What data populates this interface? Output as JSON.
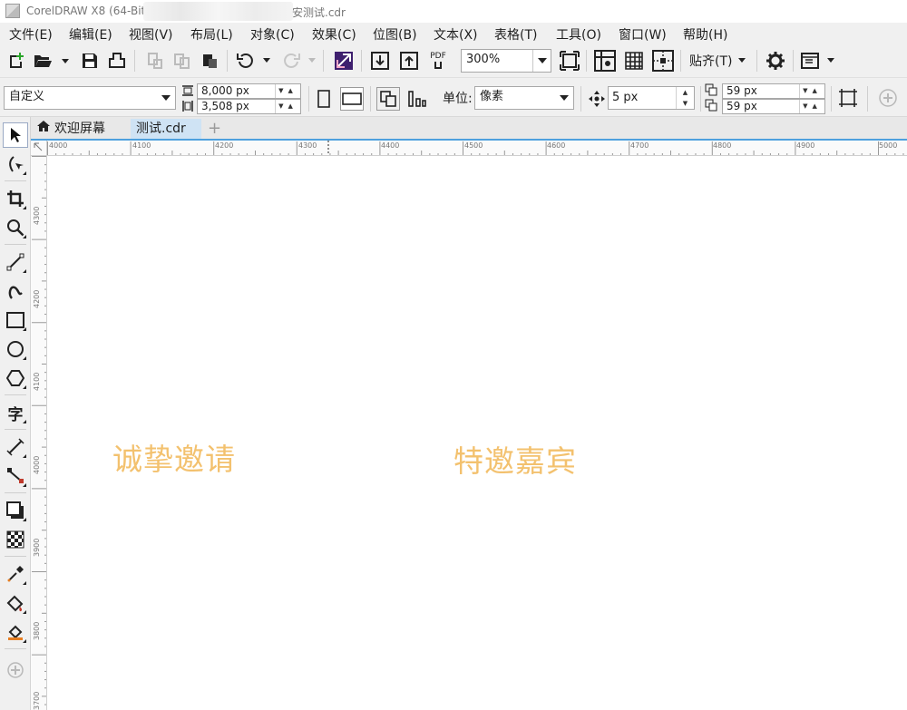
{
  "window": {
    "app_title": "CorelDRAW X8 (64-Bit)",
    "file_fragment": "安测试.cdr"
  },
  "menu": [
    "文件(E)",
    "编辑(E)",
    "视图(V)",
    "布局(L)",
    "对象(C)",
    "效果(C)",
    "位图(B)",
    "文本(X)",
    "表格(T)",
    "工具(O)",
    "窗口(W)",
    "帮助(H)"
  ],
  "standard_toolbar": {
    "pdf_label": "PDF",
    "zoom_value": "300%",
    "snap_label": "贴齐(T)"
  },
  "property_bar": {
    "page_preset": "自定义",
    "width": "8,000 px",
    "height": "3,508 px",
    "unit_label": "单位:",
    "unit_value": "像素",
    "nudge": "5 px",
    "dup_x": "59 px",
    "dup_y": "59 px"
  },
  "tabs": {
    "welcome": "欢迎屏幕",
    "document": "测试.cdr",
    "add": "+"
  },
  "rulers": {
    "horizontal": [
      "4000",
      "4100",
      "4200",
      "4300",
      "4400",
      "4500",
      "4600",
      "4700",
      "4800",
      "4900",
      "5000"
    ],
    "vertical": [
      "4300",
      "4200",
      "4100",
      "4000",
      "3900",
      "3800",
      "3700"
    ]
  },
  "canvas": {
    "text1": "诚挚邀请",
    "text2": "特邀嘉宾",
    "text_color": "#f3c16e"
  }
}
